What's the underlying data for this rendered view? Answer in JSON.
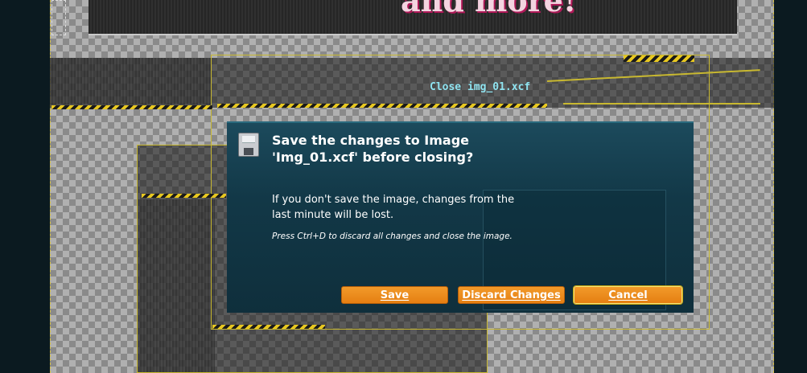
{
  "banner": {
    "text": "and more!"
  },
  "window": {
    "title": "Close img_01.xcf"
  },
  "dialog": {
    "heading": "Save the changes to Image 'Img_01.xcf' before closing?",
    "body": "If you don't save the image, changes from the last minute will be lost.",
    "hint": "Press Ctrl+D to discard all changes and close the image.",
    "icon": "floppy-disk-icon"
  },
  "buttons": {
    "save": "Save",
    "discard": "Discard Changes",
    "cancel": "Cancel"
  },
  "colors": {
    "accent": "#e8891a",
    "frame": "#c8b830",
    "dialog_bg": "#123847",
    "title_text": "#8fe3f0"
  }
}
